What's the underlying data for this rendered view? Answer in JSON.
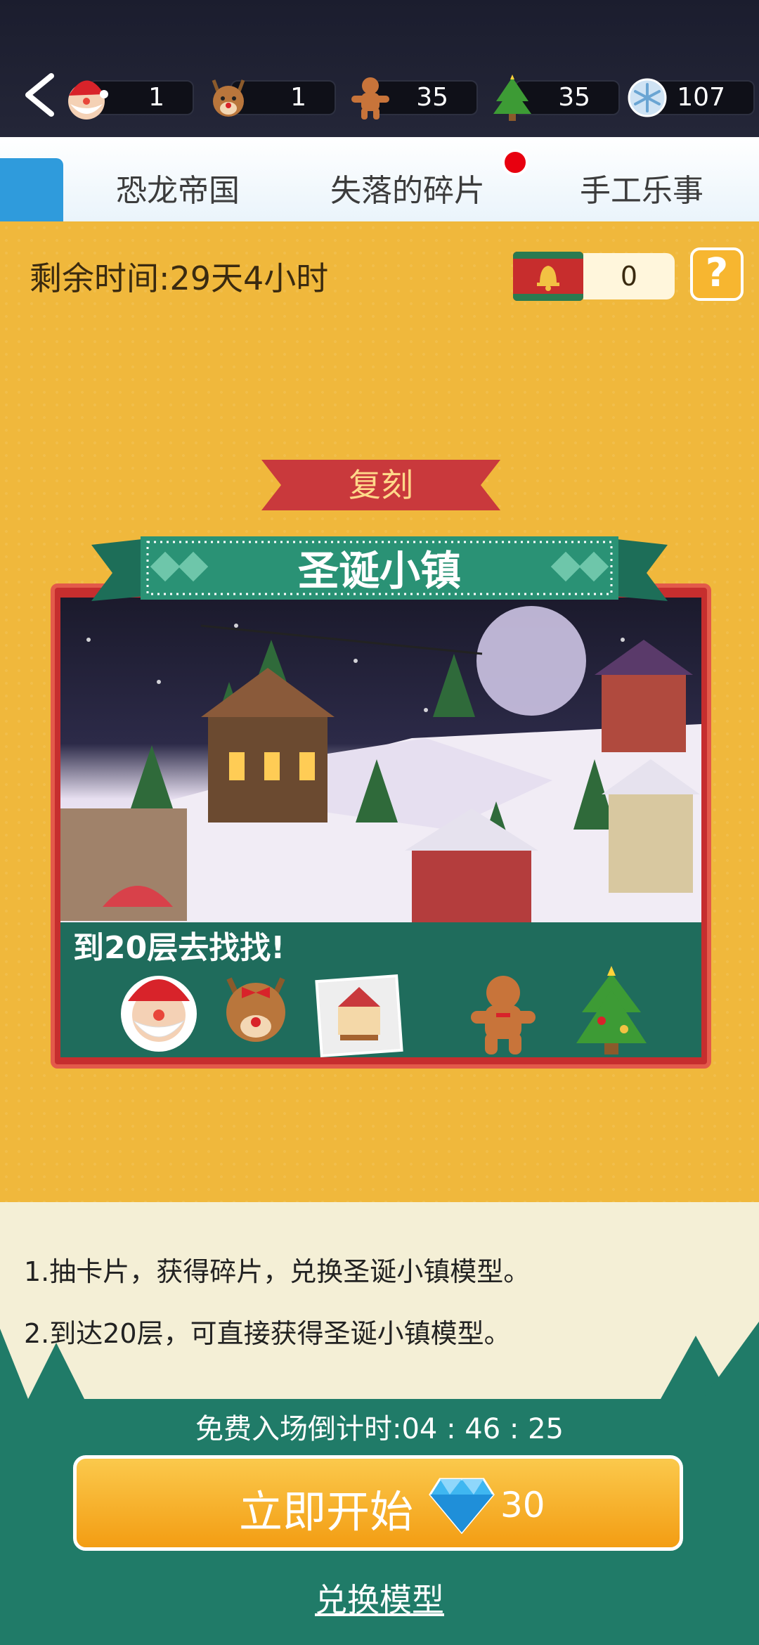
{
  "resources": {
    "santa": "1",
    "reindeer": "1",
    "gingerbread": "35",
    "tree": "35",
    "snowflake": "107"
  },
  "tabs": [
    "恐龙帝国",
    "失落的碎片",
    "手工乐事"
  ],
  "panel": {
    "remaining_time": "剩余时间:29天4小时",
    "ticket_count": "0",
    "help_label": "?"
  },
  "event": {
    "badge": "复刻",
    "title": "圣诞小镇",
    "find_text": "到20层去找找!"
  },
  "rules": {
    "line1": "1.抽卡片，获得碎片，兑换圣诞小镇模型。",
    "line2": "2.到达20层，可直接获得圣诞小镇模型。"
  },
  "footer": {
    "countdown": "免费入场倒计时:04 : 46 : 25",
    "start_label": "立即开始",
    "start_cost": "30",
    "exchange_label": "兑换模型"
  },
  "colors": {
    "panel_bg": "#f0b83c",
    "accent_green": "#207b68",
    "accent_red": "#c62e2e",
    "button_orange": "#f39d13"
  }
}
